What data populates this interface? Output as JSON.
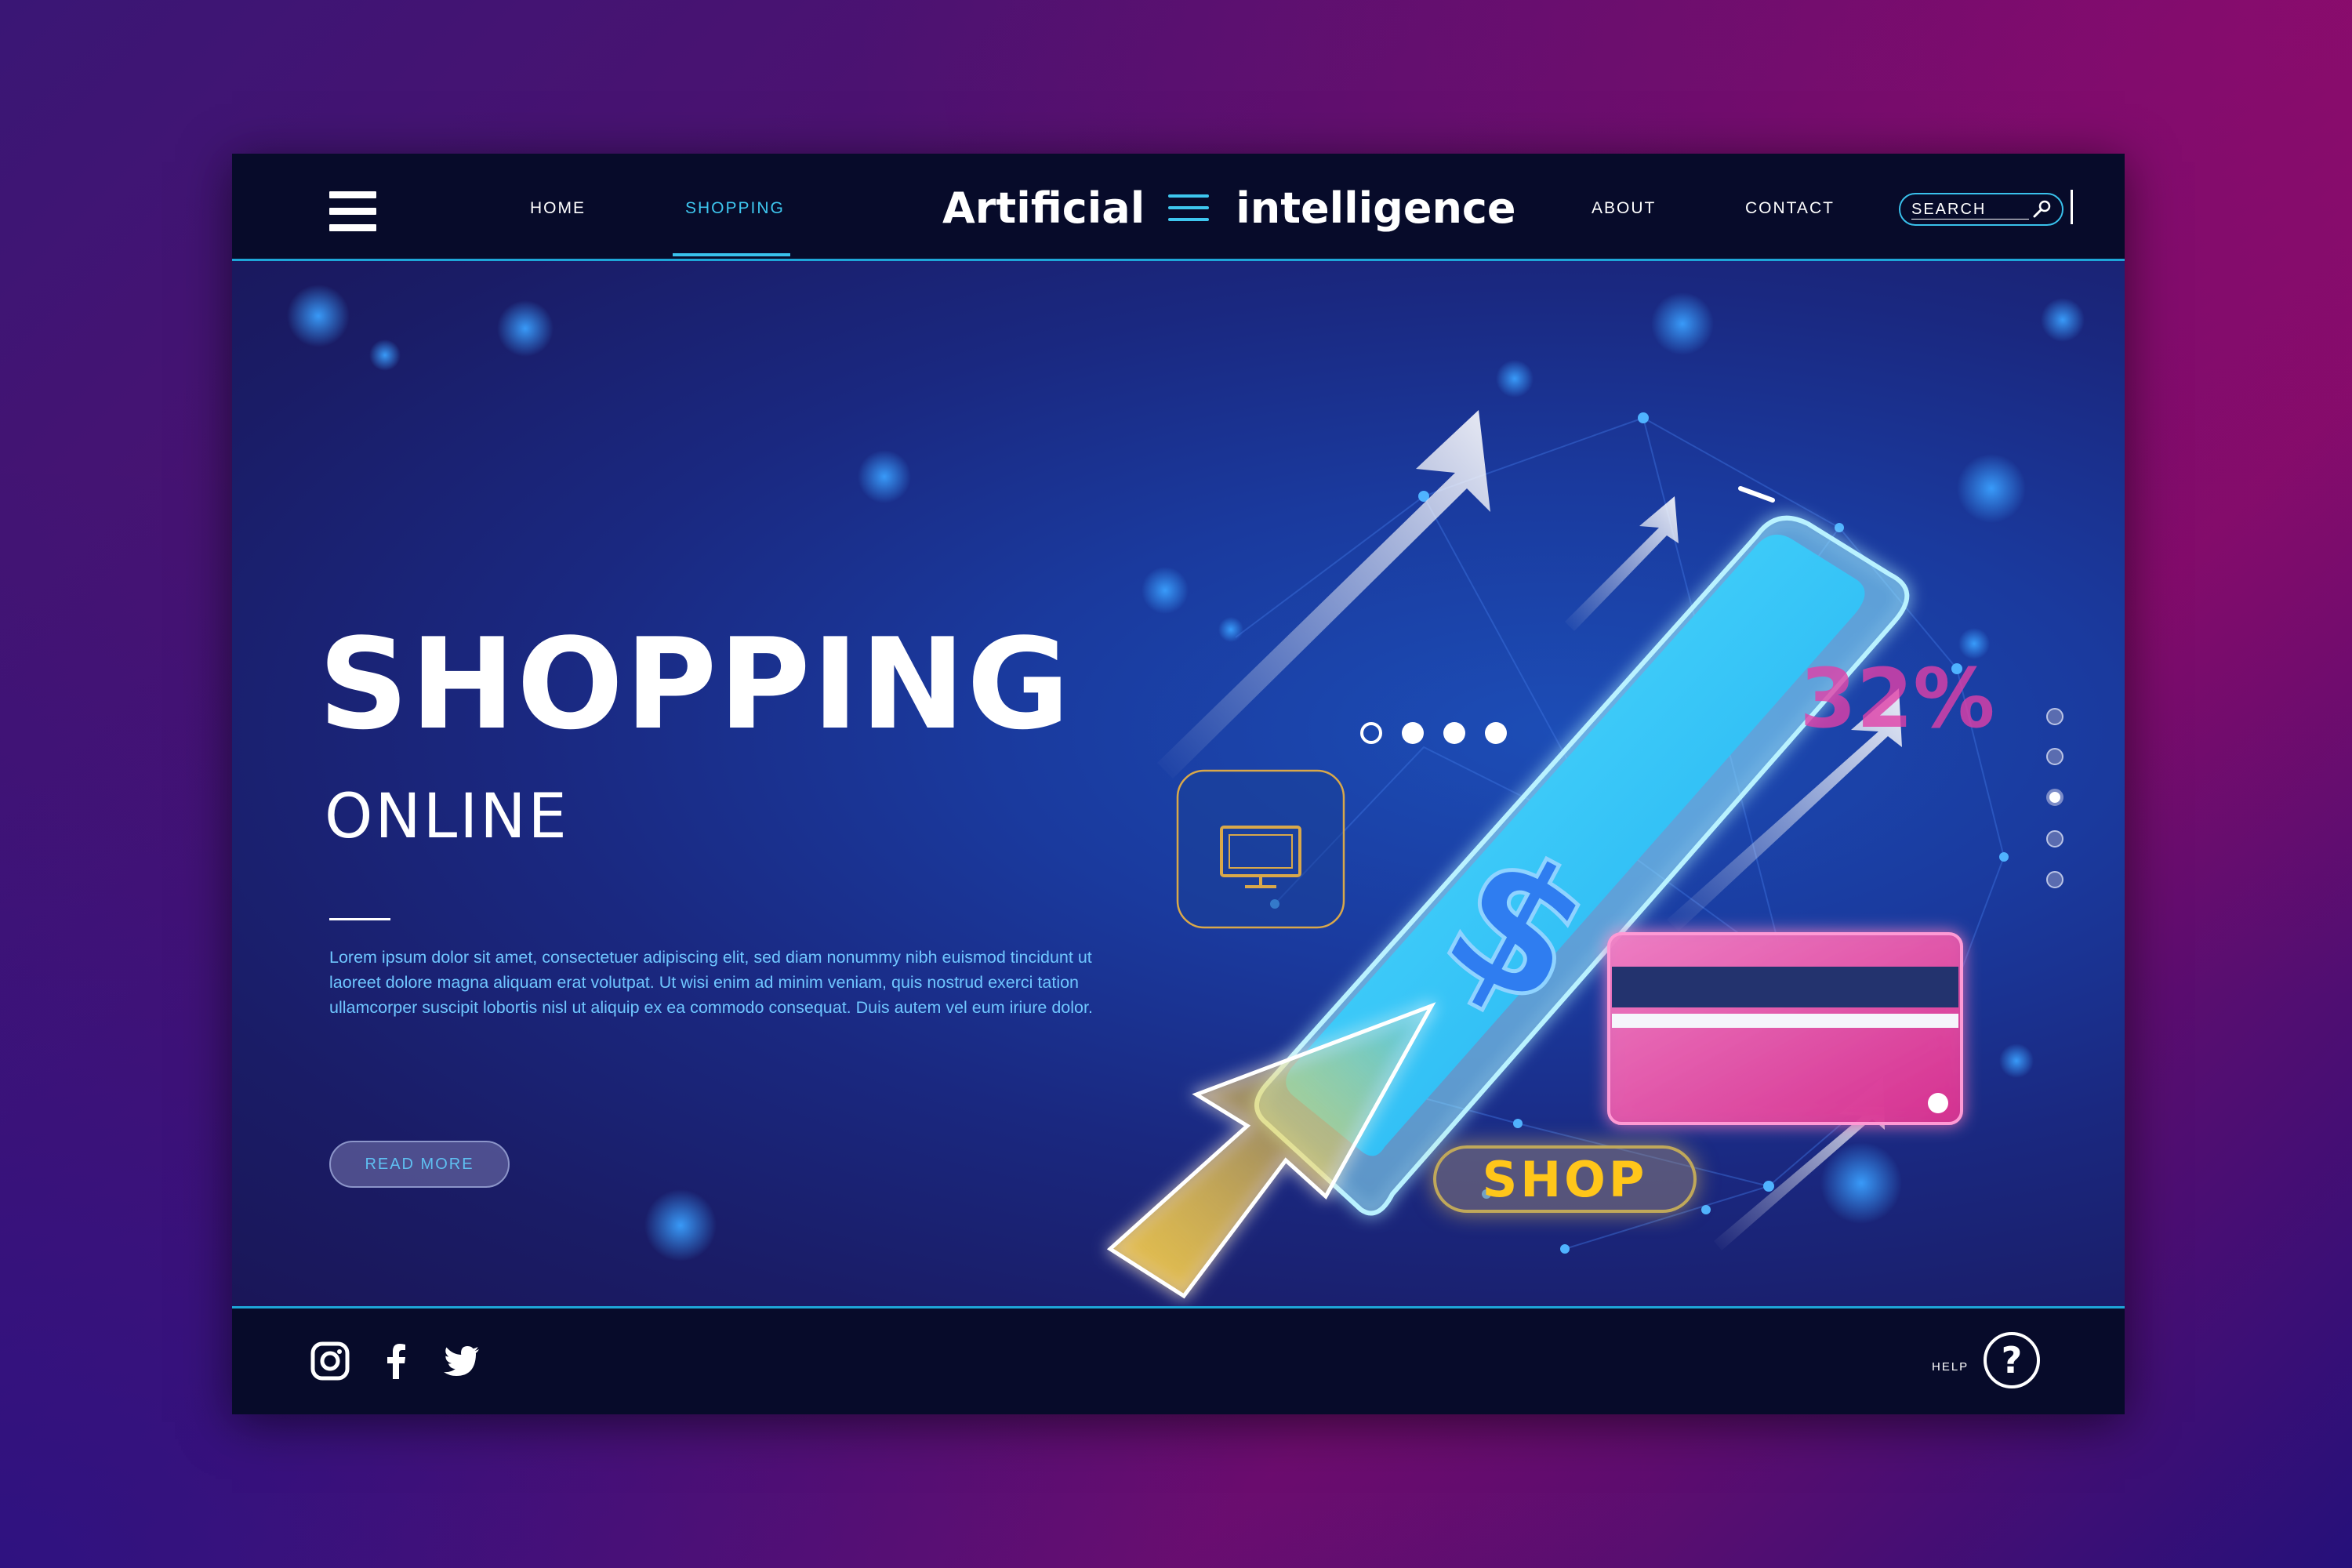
{
  "header": {
    "nav": [
      "HOME",
      "SHOPPING",
      "ABOUT",
      "CONTACT"
    ],
    "active_nav": "SHOPPING",
    "brand_left": "Artificial",
    "brand_right": "intelligence",
    "search_placeholder": "SEARCH"
  },
  "hero": {
    "title": "SHOPPING",
    "subtitle": "ONLINE",
    "body": "Lorem ipsum dolor sit amet, consectetuer adipiscing elit, sed diam nonummy nibh euismod tincidunt ut laoreet dolore magna aliquam erat volutpat. Ut wisi enim ad minim veniam, quis nostrud exerci tation ullamcorper suscipit lobortis nisl ut aliquip ex ea commodo consequat. Duis autem vel eum iriure dolor.",
    "read_more": "READ MORE"
  },
  "illustration": {
    "discount": "32%",
    "shop_button": "SHOP",
    "icons": [
      "phone-icon",
      "dollar-sign-icon",
      "credit-card-icon",
      "cursor-arrow-icon",
      "monitor-icon",
      "arrow-up-right-icon"
    ]
  },
  "slider": {
    "total": 5,
    "active_index": 3
  },
  "footer": {
    "social": [
      "instagram-icon",
      "facebook-icon",
      "twitter-icon"
    ],
    "help_label": "HELP",
    "help_symbol": "?"
  },
  "colors": {
    "accent": "#3ec7ef",
    "bar": "#070b2a",
    "hero": "#1a2880",
    "pink": "#e040a8",
    "shop_yellow": "#ffc61a"
  }
}
